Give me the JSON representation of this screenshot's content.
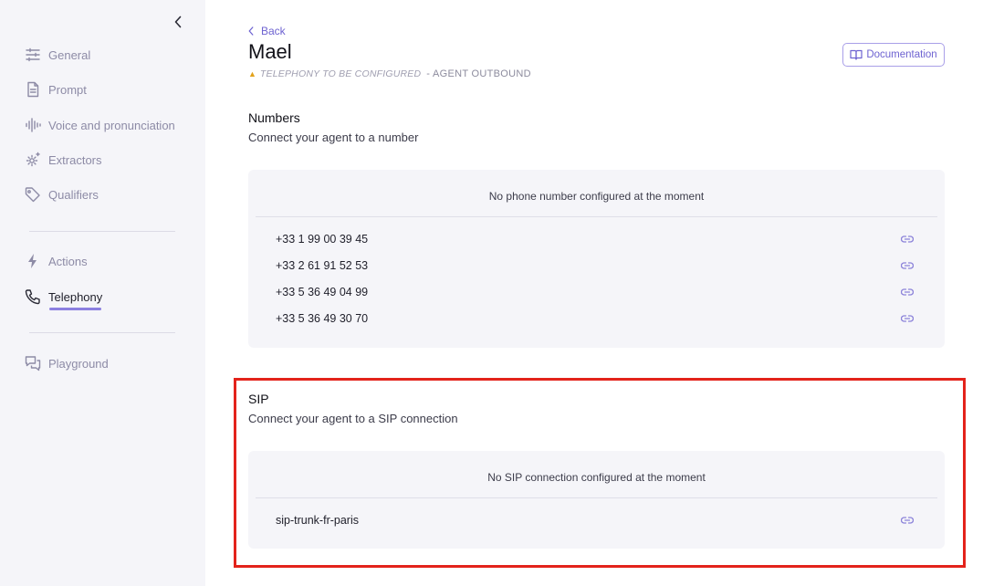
{
  "sidebar": {
    "items": [
      {
        "label": "General",
        "icon": "sliders-icon"
      },
      {
        "label": "Prompt",
        "icon": "document-icon"
      },
      {
        "label": "Voice and pronunciation",
        "icon": "waveform-icon"
      },
      {
        "label": "Extractors",
        "icon": "gear-sparkle-icon"
      },
      {
        "label": "Qualifiers",
        "icon": "tag-icon"
      },
      {
        "label": "Actions",
        "icon": "lightning-icon"
      },
      {
        "label": "Telephony",
        "icon": "phone-icon",
        "active": true
      },
      {
        "label": "Playground",
        "icon": "chat-icon"
      }
    ]
  },
  "header": {
    "back_label": "Back",
    "title": "Mael",
    "status_warning": "TELEPHONY TO BE CONFIGURED",
    "status_agent": "- AGENT OUTBOUND",
    "documentation_label": "Documentation"
  },
  "numbers": {
    "title": "Numbers",
    "subtitle": "Connect your agent to a number",
    "empty": "No phone number configured at the moment",
    "items": [
      "+33 1 99 00 39 45",
      "+33 2 61 91 52 53",
      "+33 5 36 49 04 99",
      "+33 5 36 49 30 70"
    ]
  },
  "sip": {
    "title": "SIP",
    "subtitle": "Connect your agent to a SIP connection",
    "empty": "No SIP connection configured at the moment",
    "items": [
      "sip-trunk-fr-paris"
    ]
  },
  "colors": {
    "accent": "#6e63d1",
    "highlight": "#e3231b",
    "sidebar_bg": "#f5f5f9",
    "warning": "#e2a21b"
  }
}
